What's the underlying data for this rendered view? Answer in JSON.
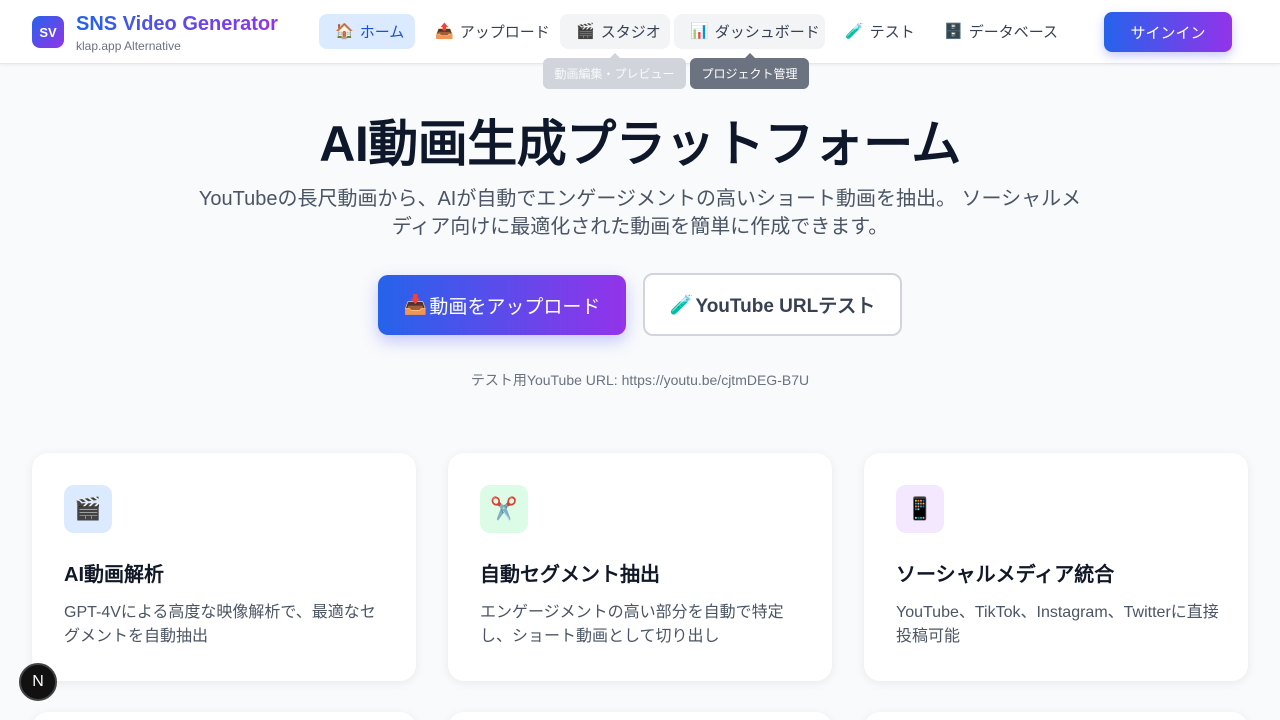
{
  "header": {
    "logo_text": "SV",
    "brand_title": "SNS Video Generator",
    "brand_subtitle": "klap.app Alternative",
    "nav": [
      {
        "icon": "🏠",
        "label": "ホーム",
        "state": "active"
      },
      {
        "icon": "📤",
        "label": "アップロード",
        "state": "normal"
      },
      {
        "icon": "🎬",
        "label": "スタジオ",
        "state": "hovered"
      },
      {
        "icon": "📊",
        "label": "ダッシュボード",
        "state": "hovered"
      },
      {
        "icon": "🧪",
        "label": "テスト",
        "state": "normal"
      },
      {
        "icon": "🗄️",
        "label": "データベース",
        "state": "normal"
      }
    ],
    "signin_label": "サインイン"
  },
  "tooltips": {
    "studio": "動画編集・プレビュー",
    "dashboard": "プロジェクト管理"
  },
  "hero": {
    "title": "AI動画生成プラットフォーム",
    "description_line1": "YouTubeの長尺動画から、AIが自動でエンゲージメントの高いショート動画を抽出。 ソーシャルメ",
    "description_line2": "ディア向けに最適化された動画を簡単に作成できます。",
    "primary_button": {
      "icon": "📥",
      "label": "動画をアップロード"
    },
    "secondary_button": {
      "icon": "🧪",
      "label": "YouTube URLテスト"
    },
    "test_url_text": "テスト用YouTube URL: https://youtu.be/cjtmDEG-B7U"
  },
  "features": [
    {
      "icon": "🎬",
      "icon_bg": "#dbeafe",
      "title": "AI動画解析",
      "desc": "GPT-4Vによる高度な映像解析で、最適なセグメントを自動抽出"
    },
    {
      "icon": "✂️",
      "icon_bg": "#dcfce7",
      "title": "自動セグメント抽出",
      "desc": "エンゲージメントの高い部分を自動で特定し、ショート動画として切り出し"
    },
    {
      "icon": "📱",
      "icon_bg": "#f3e8ff",
      "title": "ソーシャルメディア統合",
      "desc": "YouTube、TikTok、Instagram、Twitterに直接投稿可能"
    }
  ],
  "dev_badge": "N",
  "colors": {
    "accent_start": "#2563eb",
    "accent_end": "#9333ea",
    "active_nav_bg": "#dbeafe",
    "page_bg": "#f8fafc"
  }
}
